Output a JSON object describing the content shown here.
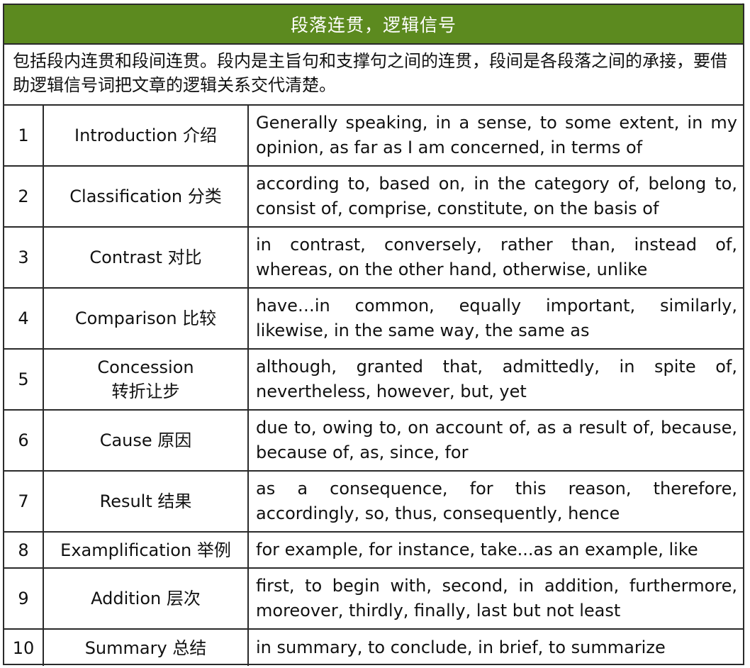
{
  "title": "段落连贯，逻辑信号",
  "intro": "包括段内连贯和段间连贯。段内是主旨句和支撑句之间的连贯，段间是各段落之间的承接，要借助逻辑信号词把文章的逻辑关系交代清楚。",
  "rows": [
    {
      "num": "1",
      "category": [
        "Introduction 介绍"
      ],
      "words": "Generally speaking, in a sense, to some extent, in my opinion, as far as I am concerned, in terms of"
    },
    {
      "num": "2",
      "category": [
        "Classification 分类"
      ],
      "words": "according to, based on, in the category of, belong to, consist of, comprise, constitute, on the basis of"
    },
    {
      "num": "3",
      "category": [
        "Contrast 对比"
      ],
      "words": "in contrast, conversely, rather than, instead of, whereas, on the other hand, otherwise, unlike"
    },
    {
      "num": "4",
      "category": [
        "Comparison 比较"
      ],
      "words": "have…in common, equally important, similarly, likewise, in the same way, the same as"
    },
    {
      "num": "5",
      "category": [
        "Concession",
        "转折让步"
      ],
      "words": "although, granted that, admittedly, in spite of, nevertheless, however, but, yet"
    },
    {
      "num": "6",
      "category": [
        "Cause 原因"
      ],
      "words": "due to, owing to, on account of, as a result of, because, because of, as, since, for"
    },
    {
      "num": "7",
      "category": [
        "Result 结果"
      ],
      "words": "as a consequence, for this reason, therefore, accordingly, so, thus, consequently, hence"
    },
    {
      "num": "8",
      "category": [
        "Examplification 举例"
      ],
      "words": "for example, for instance, take...as an example, like"
    },
    {
      "num": "9",
      "category": [
        "Addition 层次"
      ],
      "words": "first, to begin with, second, in addition, furthermore, moreover, thirdly, finally, last but not least"
    },
    {
      "num": "10",
      "category": [
        "Summary 总结"
      ],
      "words": "in summary, to conclude, in brief, to summarize"
    }
  ],
  "colors": {
    "title_bg": "#5c8a1f",
    "title_text": "#ffffff",
    "border": "#2a2a2a"
  }
}
